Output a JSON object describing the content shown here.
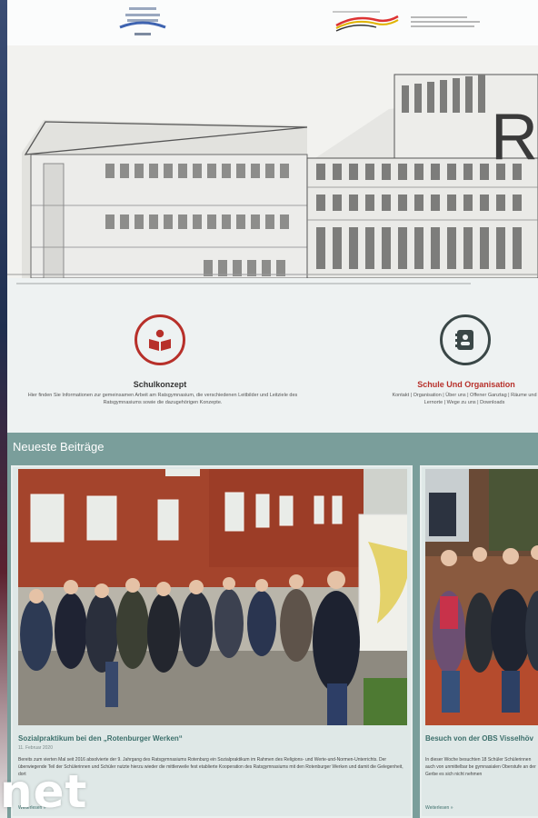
{
  "hero": {
    "title_partial": "R"
  },
  "features": [
    {
      "icon": "book-reader-icon",
      "title": "Schulkonzept",
      "text": "Hier finden Sie Informationen zur gemeinsamen Arbeit am Ratsgymnasium, die verschiedenen Leitbilder und Leitziele des Ratsgymnasiums sowie die dazugehörigen Konzepte.",
      "color": "#b7302a"
    },
    {
      "icon": "contact-book-icon",
      "title": "Schule Und Organisation",
      "text": "Kontakt | Organisation | Über uns | Offener Ganztag | Räume und Lernorte | Wege zu uns | Downloads",
      "color": "#3a4747"
    }
  ],
  "posts": {
    "heading": "Neueste Beiträge",
    "items": [
      {
        "title": "Sozialpraktikum bei den „Rotenburger Werken“",
        "date": "11. Februar 2020",
        "text": "Bereits zum vierten Mal seit 2016 absolvierte der 9. Jahrgang des Ratsgymnasiums Rotenburg ein Sozialpraktikum im Rahmen des Religions- und Werte-und-Normen-Unterrichts. Der überwiegende Teil der Schülerinnen und Schüler nutzte hierzu wieder die mittlerweile fest etablierte Kooperation des Ratsgymnasiums mit den Rotenburger Werken und damit die Gelegenheit, dort",
        "more": "Weiterlesen »"
      },
      {
        "title": "Besuch von der OBS Visselhöv",
        "date": "",
        "text": "In dieser Woche besuchten 18 Schüler Schülerinnen auch von unmittelbar be gymnasialen Oberstufe an der Gerbe es sich nicht nehmen",
        "more": "Weiterlesen »"
      }
    ]
  },
  "watermark": "net",
  "colors": {
    "accent_red": "#b7302a",
    "teal": "#7a9e9b",
    "teal_dark": "#3c6f6b"
  }
}
